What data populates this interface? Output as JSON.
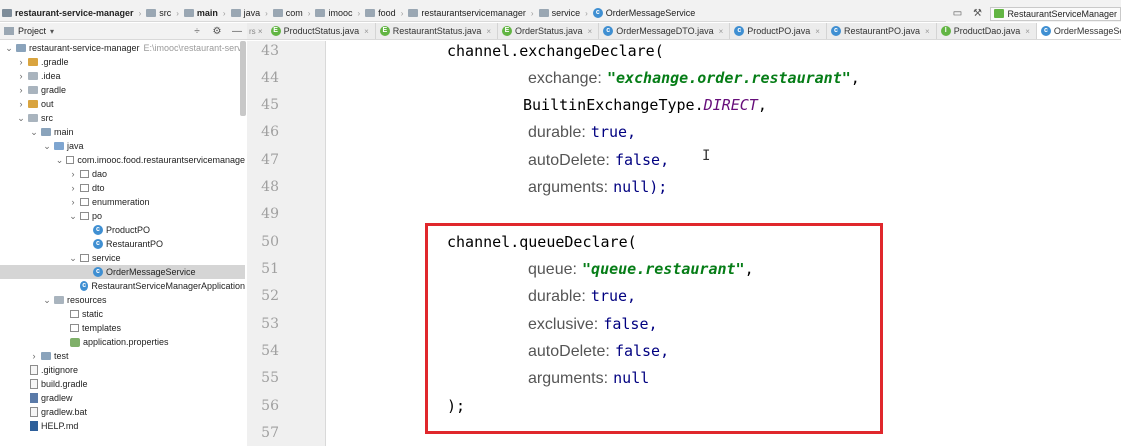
{
  "breadcrumb": [
    "restaurant-service-manager",
    "src",
    "main",
    "java",
    "com",
    "imooc",
    "food",
    "restaurantservicemanager",
    "service",
    "OrderMessageService"
  ],
  "run_config": "RestaurantServiceManager",
  "project_panel": {
    "title": "Project",
    "caret": "▾"
  },
  "tabs": [
    "ProductStatus.java",
    "RestaurantStatus.java",
    "OrderStatus.java",
    "OrderMessageDTO.java",
    "ProductPO.java",
    "RestaurantPO.java",
    "ProductDao.java",
    "OrderMessageService.j"
  ],
  "tree": [
    {
      "label": "restaurant-service-manager",
      "path": "E:\\imooc\\restaurant-servi"
    },
    {
      "label": ".gradle"
    },
    {
      "label": ".idea"
    },
    {
      "label": "gradle"
    },
    {
      "label": "out"
    },
    {
      "label": "src"
    },
    {
      "label": "main"
    },
    {
      "label": "java"
    },
    {
      "label": "com.imooc.food.restaurantservicemanage"
    },
    {
      "label": "dao"
    },
    {
      "label": "dto"
    },
    {
      "label": "enummeration"
    },
    {
      "label": "po"
    },
    {
      "label": "ProductPO"
    },
    {
      "label": "RestaurantPO"
    },
    {
      "label": "service"
    },
    {
      "label": "OrderMessageService"
    },
    {
      "label": "RestaurantServiceManagerApplication"
    },
    {
      "label": "resources"
    },
    {
      "label": "static"
    },
    {
      "label": "templates"
    },
    {
      "label": "application.properties"
    },
    {
      "label": "test"
    },
    {
      "label": ".gitignore"
    },
    {
      "label": "build.gradle"
    },
    {
      "label": "gradlew"
    },
    {
      "label": "gradlew.bat"
    },
    {
      "label": "HELP.md"
    }
  ],
  "line_numbers": [
    "43",
    "44",
    "45",
    "46",
    "47",
    "48",
    "49",
    "50",
    "51",
    "52",
    "53",
    "54",
    "55",
    "56",
    "57"
  ],
  "code": {
    "l43": "channel.exchangeDeclare(",
    "l44_hint": "exchange:",
    "l44_str": "\"exchange.order.restaurant\"",
    "l44_tail": ",",
    "l45_pre": "BuiltinExchangeType.",
    "l45_const": "DIRECT",
    "l45_tail": ",",
    "l46_hint": "durable:",
    "l46_val": "true,",
    "l47_hint": "autoDelete:",
    "l47_val": "false,",
    "l48_hint": "arguments:",
    "l48_val": "null);",
    "l50": "channel.queueDeclare(",
    "l51_hint": "queue:",
    "l51_str": "\"queue.restaurant\"",
    "l51_tail": ",",
    "l52_hint": "durable:",
    "l52_val": "true,",
    "l53_hint": "exclusive:",
    "l53_val": "false,",
    "l54_hint": "autoDelete:",
    "l54_val": "false,",
    "l55_hint": "arguments:",
    "l55_val": "null",
    "l56": ");"
  },
  "colors": {
    "highlight_border": "#e0272c",
    "string": "#067d17",
    "keyword": "#000080",
    "constant": "#660e7a"
  }
}
